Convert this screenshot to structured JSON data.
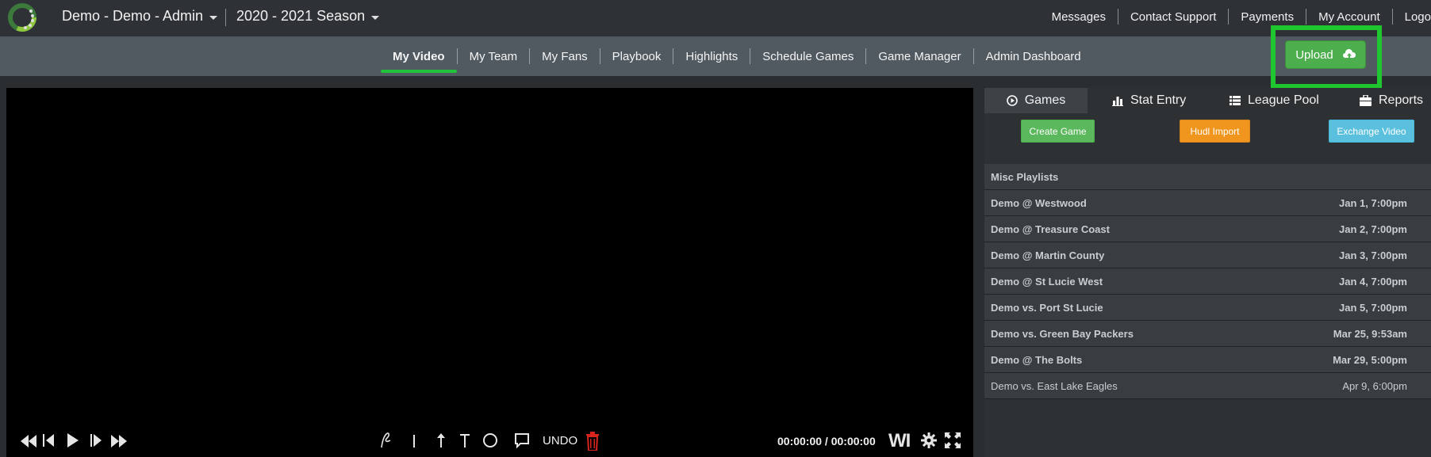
{
  "header": {
    "team": "Demo - Demo - Admin",
    "season": "2020 - 2021 Season",
    "links": [
      "Messages",
      "Contact Support",
      "Payments",
      "My Account",
      "Logo"
    ]
  },
  "nav": {
    "items": [
      "My Video",
      "My Team",
      "My Fans",
      "Playbook",
      "Highlights",
      "Schedule Games",
      "Game Manager",
      "Admin Dashboard"
    ],
    "active": "My Video",
    "upload_label": "Upload"
  },
  "player": {
    "undo_label": "UNDO",
    "timecode": "00:00:00 / 00:00:00",
    "wi_label": "WI"
  },
  "panel": {
    "tabs": [
      "Games",
      "Stat Entry",
      "League Pool",
      "Reports"
    ],
    "actions": {
      "create_game": "Create Game",
      "hudl_import": "Hudl Import",
      "exchange_video": "Exchange Video"
    },
    "misc_playlists": "Misc Playlists",
    "games": [
      {
        "name": "Demo @ Westwood",
        "date": "Jan 1, 7:00pm"
      },
      {
        "name": "Demo @ Treasure Coast",
        "date": "Jan 2, 7:00pm"
      },
      {
        "name": "Demo @ Martin County",
        "date": "Jan 3, 7:00pm"
      },
      {
        "name": "Demo @ St Lucie West",
        "date": "Jan 4, 7:00pm"
      },
      {
        "name": "Demo vs. Port St Lucie",
        "date": "Jan 5, 7:00pm"
      },
      {
        "name": "Demo vs. Green Bay Packers",
        "date": "Mar 25, 9:53am"
      },
      {
        "name": "Demo @ The Bolts",
        "date": "Mar 29, 5:00pm"
      },
      {
        "name": "Demo vs. East Lake Eagles",
        "date": "Apr 9, 6:00pm"
      }
    ]
  },
  "colors": {
    "accent_green": "#21c33b",
    "create_green": "#5cb85c",
    "hudl_orange": "#f0961e",
    "exchange_blue": "#5bc0de",
    "trash_red": "#d9231d"
  }
}
